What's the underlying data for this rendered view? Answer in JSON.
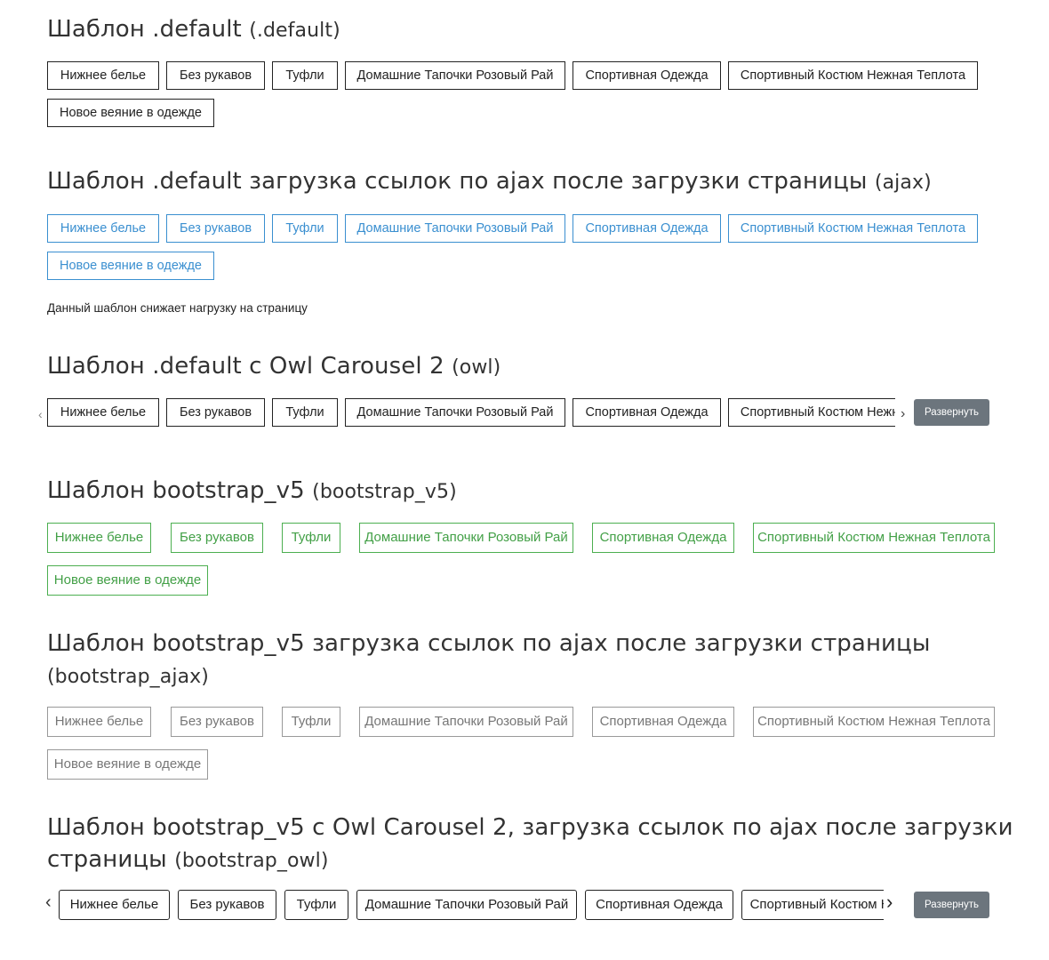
{
  "tags": [
    "Нижнее белье",
    "Без рукавов",
    "Туфли",
    "Домашние Тапочки Розовый Рай",
    "Спортивная Одежда",
    "Спортивный Костюм Нежная Теплота",
    "Новое веяние в одежде"
  ],
  "sections": {
    "s1": {
      "title": "Шаблон .default",
      "code": "(.default)"
    },
    "s2": {
      "title": "Шаблон .default загрузка ссылок по ajax после загрузки страницы",
      "code": "(ajax)",
      "note": "Данный шаблон снижает нагрузку на страницу"
    },
    "s3": {
      "title": "Шаблон .default с Owl Carousel 2",
      "code": "(owl)",
      "expand": "Развернуть"
    },
    "s4": {
      "title": "Шаблон bootstrap_v5",
      "code": "(bootstrap_v5)"
    },
    "s5": {
      "title": "Шаблон bootstrap_v5 загрузка ссылок по ajax после загрузки страницы",
      "code": "(bootstrap_ajax)"
    },
    "s6": {
      "title": "Шаблон bootstrap_v5 с Owl Carousel 2, загрузка ссылок по ajax после загрузки страницы",
      "code": "(bootstrap_owl)",
      "expand": "Развернуть"
    }
  },
  "icons": {
    "prev": "chevron-left-icon",
    "next": "chevron-right-icon"
  },
  "colors": {
    "ajax": "#3a8fd0",
    "green": "#4caf50",
    "expand_bg": "#6c757d"
  }
}
